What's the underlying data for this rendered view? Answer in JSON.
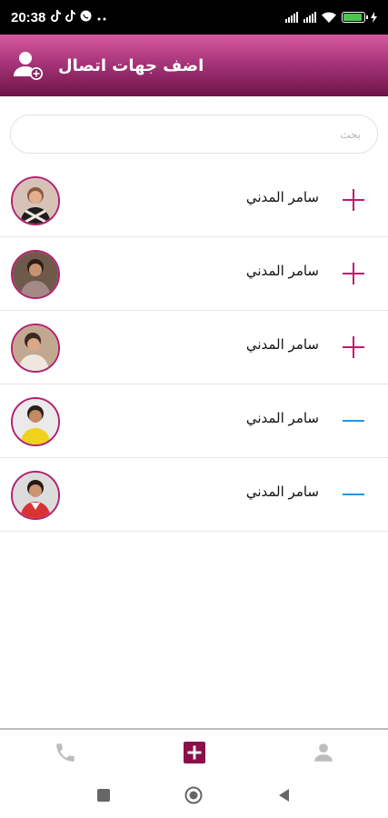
{
  "status_bar": {
    "time": "20:38",
    "left_icons": [
      "tiktok-icon",
      "tiktok-icon",
      "whatsapp-icon",
      "more-dots-icon"
    ],
    "right_icons": [
      "signal-icon",
      "signal-icon",
      "wifi-icon",
      "battery-icon",
      "charging-icon"
    ],
    "battery_level": 0.9,
    "battery_color": "#49c74a"
  },
  "app_bar": {
    "title": "اضف جهات اتصال",
    "icon": "add-contact-icon",
    "gradient": [
      "#d65b9c",
      "#a8357a",
      "#6e1448"
    ]
  },
  "search": {
    "placeholder": "بحث",
    "value": ""
  },
  "contacts": [
    {
      "name": "سامر المدني",
      "action": "add"
    },
    {
      "name": "سامر المدني",
      "action": "add"
    },
    {
      "name": "سامر المدني",
      "action": "add"
    },
    {
      "name": "سامر المدني",
      "action": "remove"
    },
    {
      "name": "سامر المدني",
      "action": "remove"
    }
  ],
  "colors": {
    "accent": "#c2186f",
    "avatar_ring": "#b2226f",
    "remove": "#2196e6",
    "nav_active": "#8b1048",
    "nav_inactive": "#bdbdbd"
  },
  "bottom_nav": {
    "items": [
      {
        "icon": "phone-icon",
        "active": false
      },
      {
        "icon": "add-box-icon",
        "active": true
      },
      {
        "icon": "person-icon",
        "active": false
      }
    ]
  },
  "system_nav": {
    "buttons": [
      "recent-apps-icon",
      "home-icon",
      "back-icon"
    ]
  }
}
